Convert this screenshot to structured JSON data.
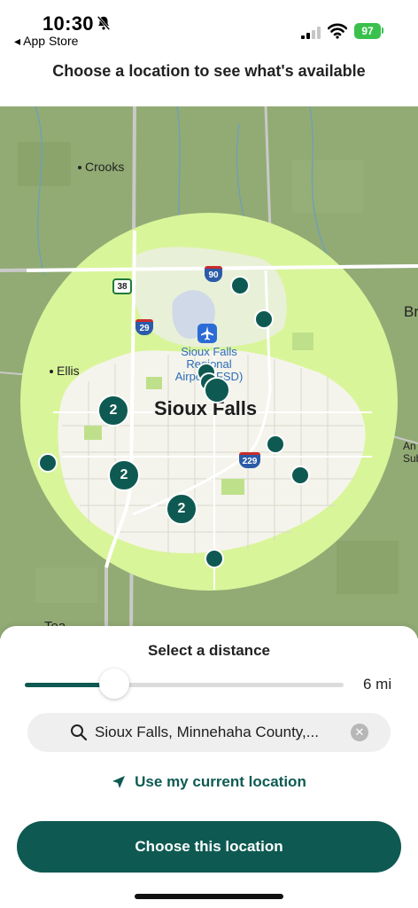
{
  "status_bar": {
    "time": "10:30",
    "back_app": "◂ App Store",
    "battery": "97"
  },
  "header": {
    "title": "Choose a location to see what's available"
  },
  "map": {
    "towns": {
      "crooks": "Crooks",
      "ellis": "Ellis",
      "tea": "Tea",
      "br": "Br",
      "an": "An",
      "sub": "Sub"
    },
    "city": "Sioux Falls",
    "airport": [
      "Sioux Falls",
      "Regional",
      "Airport (FSD)"
    ],
    "shields": {
      "i90": "90",
      "us38": "38",
      "i29": "29",
      "i229": "229"
    },
    "clusters": [
      "2",
      "2",
      "2"
    ],
    "accent_color": "#0e5a52",
    "radius_color": "#d9f59a"
  },
  "sheet": {
    "title": "Select a distance",
    "distance_value": "6 mi",
    "distance_fraction": 0.28,
    "search_value": "Sioux Falls, Minnehaha County,...",
    "current_location_label": "Use my current location",
    "choose_button_label": "Choose this location"
  }
}
